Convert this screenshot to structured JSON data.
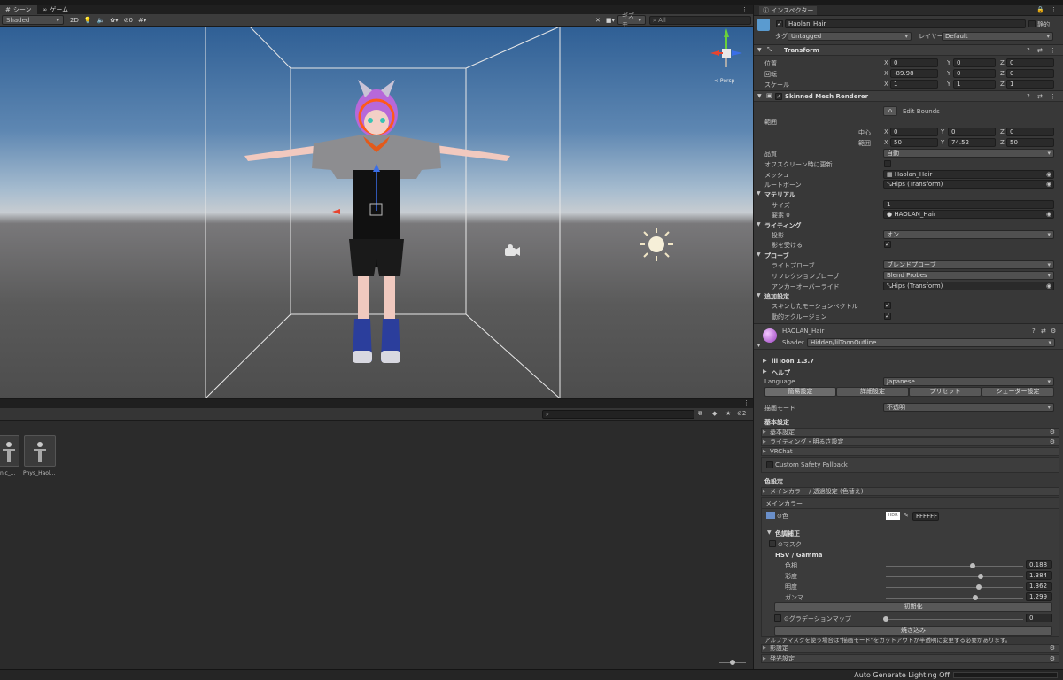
{
  "scene": {
    "tabs": [
      {
        "label": "シーン",
        "icon": "hash-icon"
      },
      {
        "label": "ゲーム",
        "icon": "gamepad-icon"
      }
    ],
    "toolbar": {
      "shading": "Shaded",
      "mode2d": "2D",
      "fx": "0",
      "gizmos": "ギズモ",
      "search_placeholder": "All"
    },
    "persp_label": "< Persp"
  },
  "project": {
    "assets": [
      {
        "label": "nic_..."
      },
      {
        "label": "Phys_Haol..."
      }
    ],
    "count": "2"
  },
  "status": {
    "text": "Auto Generate Lighting Off"
  },
  "inspector": {
    "tab": "インスペクター",
    "object": {
      "name": "Haolan_Hair",
      "static": "静的",
      "tag_label": "タグ",
      "tag": "Untagged",
      "layer_label": "レイヤー",
      "layer": "Default"
    },
    "transform": {
      "title": "Transform",
      "rows": [
        {
          "label": "位置",
          "x": "0",
          "y": "0",
          "z": "0"
        },
        {
          "label": "回転",
          "x": "-89.98",
          "y": "0",
          "z": "0"
        },
        {
          "label": "スケール",
          "x": "1",
          "y": "1",
          "z": "1"
        }
      ]
    },
    "smr": {
      "title": "Skinned Mesh Renderer",
      "edit_bounds": "Edit Bounds",
      "bounds_label": "範囲",
      "center_label": "中心",
      "center": {
        "x": "0",
        "y": "0",
        "z": "0"
      },
      "extent_label": "範囲",
      "extent": {
        "x": "50",
        "y": "74.52",
        "z": "50"
      },
      "quality_label": "品質",
      "quality": "自動",
      "offscreen_label": "オフスクリーン時に更新",
      "mesh_label": "メッシュ",
      "mesh": "Haolan_Hair",
      "rootbone_label": "ルートボーン",
      "rootbone": "Hips (Transform)",
      "materials_label": "マテリアル",
      "size_label": "サイズ",
      "size": "1",
      "element_label": "要素 0",
      "element": "HAOLAN_Hair",
      "lighting_label": "ライティング",
      "cast_label": "投影",
      "cast": "オン",
      "receive_label": "影を受ける",
      "probes_label": "プローブ",
      "lightprobe_label": "ライトプローブ",
      "lightprobe": "ブレンドプローブ",
      "refprobe_label": "リフレクションプローブ",
      "refprobe": "Blend Probes",
      "anchor_label": "アンカーオーバーライド",
      "anchor": "Hips (Transform)",
      "additional_label": "追加設定",
      "motion_label": "スキンしたモーションベクトル",
      "occlusion_label": "動的オクルージョン"
    },
    "material": {
      "name": "HAOLAN_Hair",
      "shader_label": "Shader",
      "shader": "Hidden/lilToonOutline",
      "liltoon": "lilToon 1.3.7",
      "help": "ヘルプ",
      "language_label": "Language",
      "language": "Japanese",
      "tabs": [
        "簡易設定",
        "詳細設定",
        "プリセット",
        "シェーダー設定"
      ],
      "render_mode_label": "描画モード",
      "render_mode": "不透明",
      "basic_header": "基本設定",
      "basic_sections": [
        "基本設定",
        "ライティング・明るさ設定",
        "VRChat"
      ],
      "safety": "Custom Safety Fallback",
      "color_header": "色設定",
      "main_section": "メインカラー / 透過設定 (色替え)",
      "main_color_label": "メインカラー",
      "color_label": "色",
      "hdr": "HDR",
      "color_hex": "FFFFFF",
      "tone_label": "色調補正",
      "mask_label": "マスク",
      "hsv_label": "HSV / Gamma",
      "hsv": [
        {
          "label": "色相",
          "value": "0.188",
          "pos": 0.63
        },
        {
          "label": "彩度",
          "value": "1.384",
          "pos": 0.69
        },
        {
          "label": "明度",
          "value": "1.362",
          "pos": 0.68
        },
        {
          "label": "ガンマ",
          "value": "1.299",
          "pos": 0.65
        }
      ],
      "reset": "初期化",
      "grad_label": "グラデーションマップ",
      "grad_value": "0",
      "bake": "焼き込み",
      "note": "アルファマスクを使う場合は\"描画モード\"をカットアウトか半透明に変更する必要があります。",
      "bottom_sections": [
        "影設定",
        "発光設定"
      ]
    }
  },
  "colors": {
    "accent": "#3a72b0",
    "panel": "#383838",
    "field": "#2a2a2a"
  }
}
